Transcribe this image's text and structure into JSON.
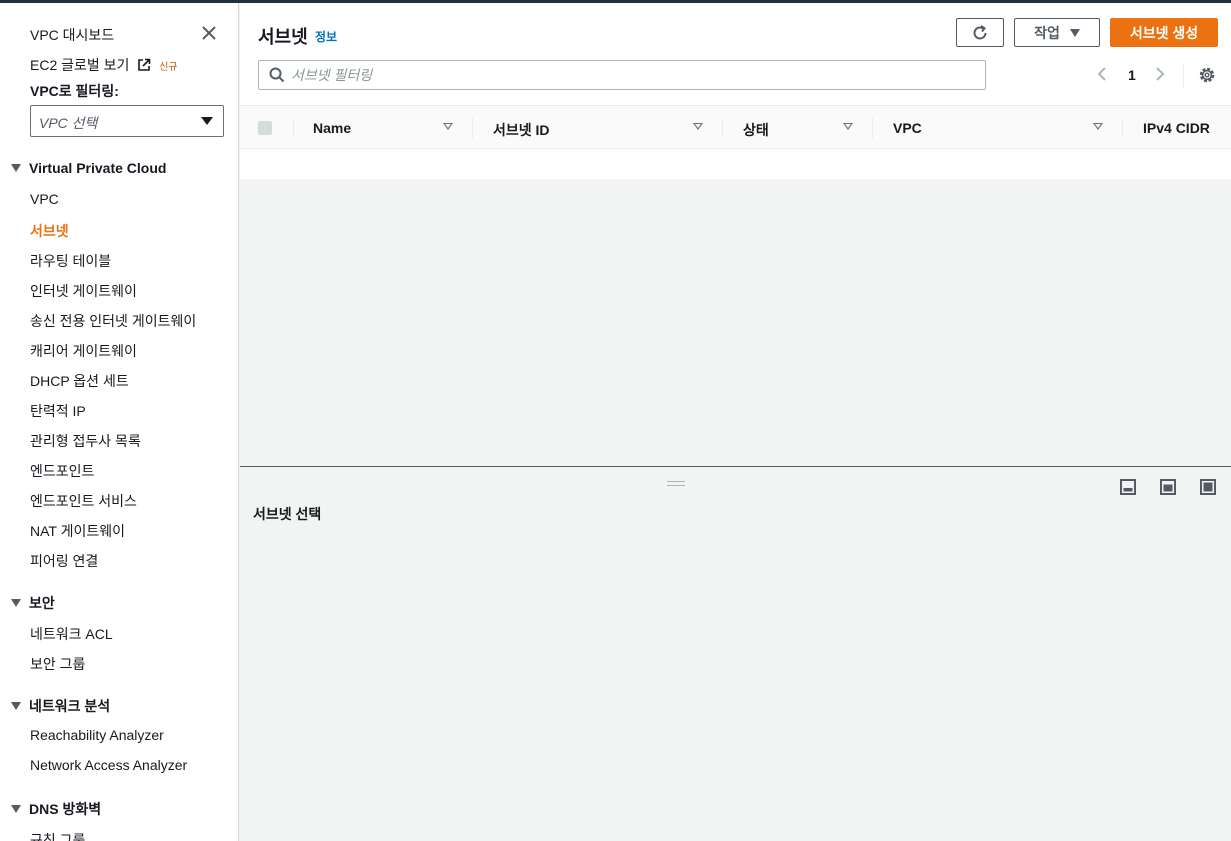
{
  "sidebar": {
    "dashboard": "VPC 대시보드",
    "ec2_global": "EC2 글로벌 보기",
    "new_badge": "신규",
    "filter_label": "VPC로 필터링:",
    "select_placeholder": "VPC 선택",
    "sections": [
      {
        "title": "Virtual Private Cloud",
        "items": [
          "VPC",
          "서브넷",
          "라우팅 테이블",
          "인터넷 게이트웨이",
          "송신 전용 인터넷 게이트웨이",
          "캐리어 게이트웨이",
          "DHCP 옵션 세트",
          "탄력적 IP",
          "관리형 접두사 목록",
          "엔드포인트",
          "엔드포인트 서비스",
          "NAT 게이트웨이",
          "피어링 연결"
        ]
      },
      {
        "title": "보안",
        "items": [
          "네트워크 ACL",
          "보안 그룹"
        ]
      },
      {
        "title": "네트워크 분석",
        "items": [
          "Reachability Analyzer",
          "Network Access Analyzer"
        ]
      },
      {
        "title": "DNS 방화벽",
        "items": [
          "규칙 그룹"
        ]
      }
    ],
    "active_item": "서브넷"
  },
  "header": {
    "title": "서브넷",
    "info": "정보",
    "action_label": "작업",
    "create_label": "서브넷 생성"
  },
  "search": {
    "placeholder": "서브넷 필터링",
    "value": ""
  },
  "pagination": {
    "current_page": "1"
  },
  "table": {
    "columns": [
      "Name",
      "서브넷 ID",
      "상태",
      "VPC",
      "IPv4 CIDR"
    ],
    "rows": []
  },
  "split_panel": {
    "title": "서브넷 선택"
  },
  "colors": {
    "accent": "#ec7211",
    "link": "#0073bb",
    "header_dark": "#232f3e"
  },
  "icons": [
    "close-icon",
    "external-link-icon",
    "refresh-icon",
    "search-icon",
    "chevron-left-icon",
    "chevron-right-icon",
    "gear-icon",
    "panel-bottom-icon",
    "panel-side-icon",
    "panel-full-icon"
  ]
}
